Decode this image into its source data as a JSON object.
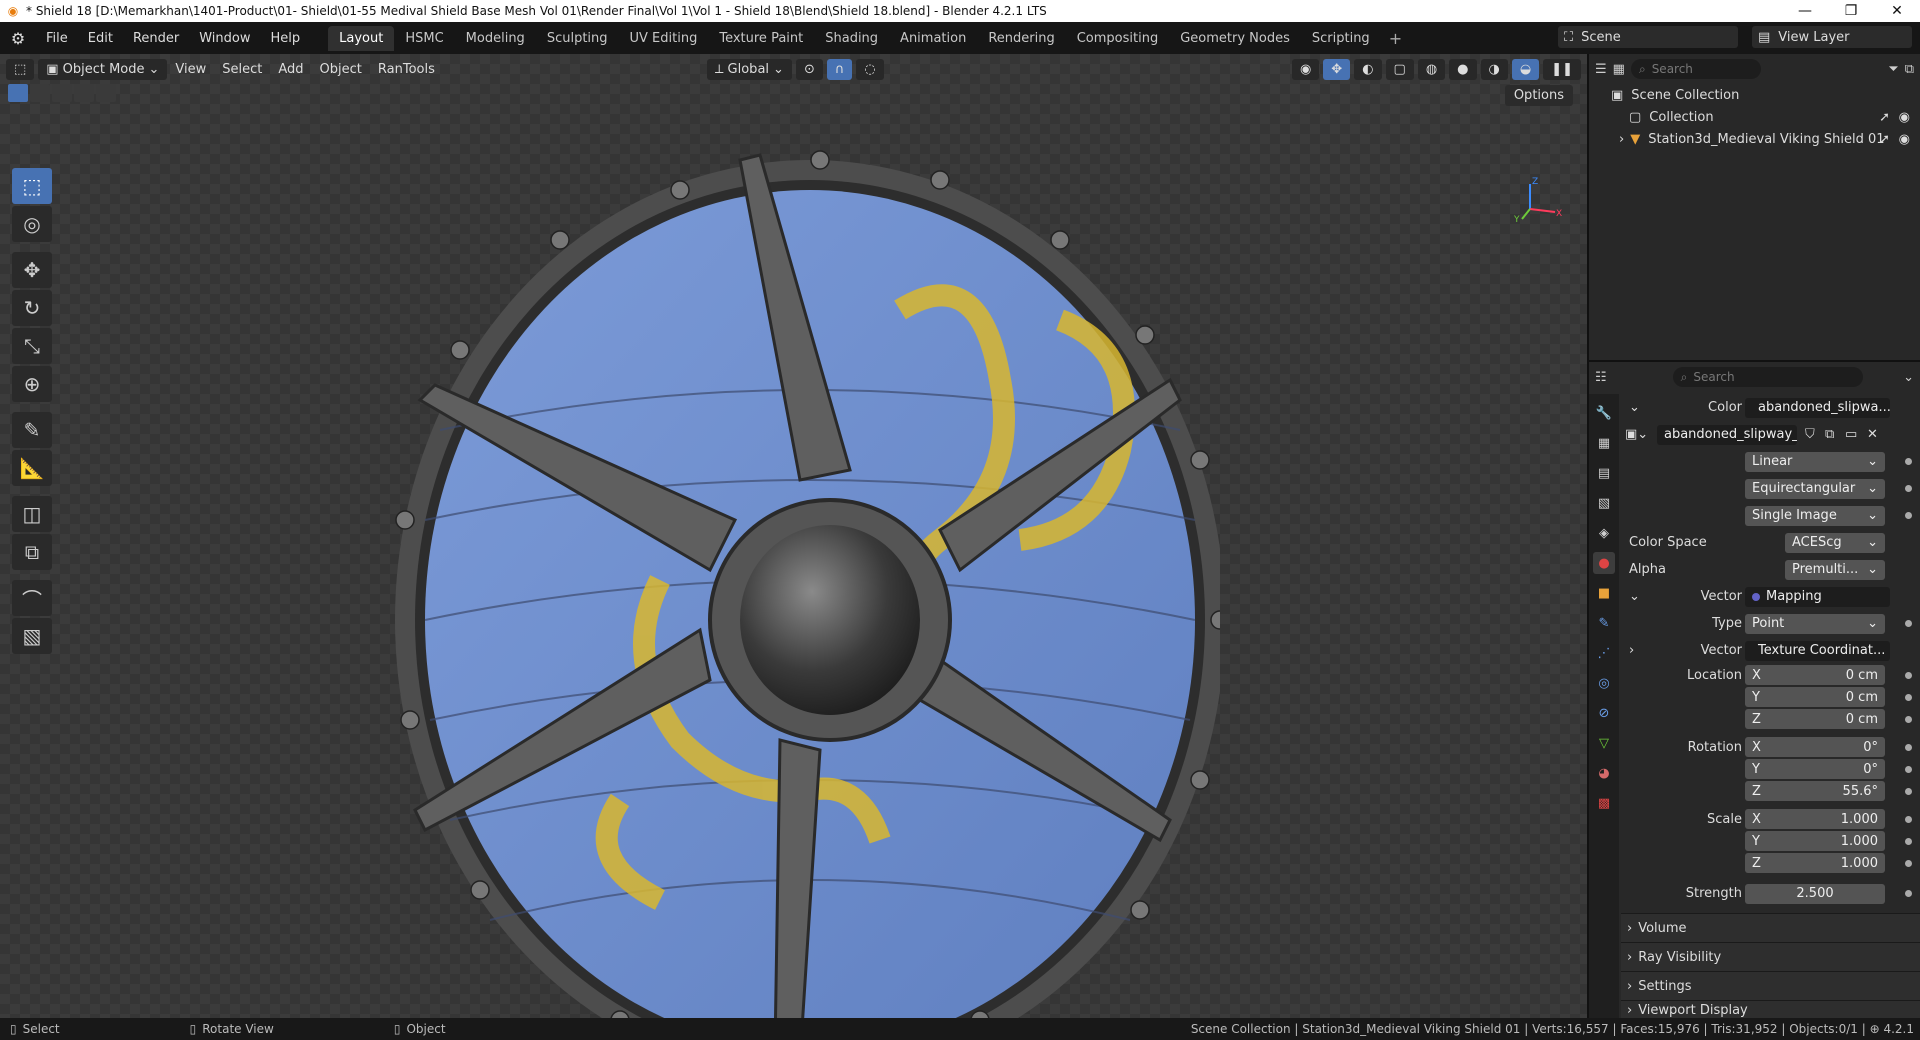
{
  "titlebar": {
    "title": "* Shield 18 [D:\\Memarkhan\\1401-Product\\01- Shield\\01-55 Medival Shield Base Mesh Vol 01\\Render Final\\Vol 1\\Vol 1 - Shield 18\\Blend\\Shield 18.blend] - Blender 4.2.1 LTS",
    "minimize": "—",
    "maximize": "❐",
    "close": "✕"
  },
  "menus": [
    "File",
    "Edit",
    "Render",
    "Window",
    "Help"
  ],
  "workspaces": [
    "Layout",
    "HSMC",
    "Modeling",
    "Sculpting",
    "UV Editing",
    "Texture Paint",
    "Shading",
    "Animation",
    "Rendering",
    "Compositing",
    "Geometry Nodes",
    "Scripting"
  ],
  "active_workspace": "Layout",
  "scene": {
    "label": "Scene",
    "view_layer": "View Layer"
  },
  "viewport": {
    "mode": "Object Mode",
    "menus": [
      "View",
      "Select",
      "Add",
      "Object",
      "RanTools"
    ],
    "transform": "Global",
    "options": "Options",
    "gizmo": {
      "x": "X",
      "y": "Y",
      "z": "Z"
    }
  },
  "outliner": {
    "search_placeholder": "Search",
    "rows": [
      {
        "label": "Scene Collection"
      },
      {
        "label": "Collection"
      },
      {
        "label": "Station3d_Medieval Viking Shield 01"
      }
    ]
  },
  "properties": {
    "search_placeholder": "Search",
    "color_label": "Color",
    "color_value": "abandoned_slipwa...",
    "image_name": "abandoned_slipway_...",
    "interpolation": "Linear",
    "projection": "Equirectangular",
    "source": "Single Image",
    "color_space_label": "Color Space",
    "color_space": "ACEScg",
    "alpha_label": "Alpha",
    "alpha": "Premulti...",
    "vector_label": "Vector",
    "vector_value": "Mapping",
    "type_label": "Type",
    "type_value": "Point",
    "vector2_label": "Vector",
    "vector2_value": "Texture Coordinat...",
    "location_label": "Location",
    "location": [
      {
        "axis": "X",
        "value": "0 cm"
      },
      {
        "axis": "Y",
        "value": "0 cm"
      },
      {
        "axis": "Z",
        "value": "0 cm"
      }
    ],
    "rotation_label": "Rotation",
    "rotation": [
      {
        "axis": "X",
        "value": "0°"
      },
      {
        "axis": "Y",
        "value": "0°"
      },
      {
        "axis": "Z",
        "value": "55.6°"
      }
    ],
    "scale_label": "Scale",
    "scale": [
      {
        "axis": "X",
        "value": "1.000"
      },
      {
        "axis": "Y",
        "value": "1.000"
      },
      {
        "axis": "Z",
        "value": "1.000"
      }
    ],
    "strength_label": "Strength",
    "strength": "2.500",
    "panels": [
      "Volume",
      "Ray Visibility",
      "Settings",
      "Viewport Display"
    ]
  },
  "status": {
    "select": "Select",
    "rotate": "Rotate View",
    "object": "Object",
    "info": "Scene Collection | Station3d_Medieval Viking Shield 01 | Verts:16,557 | Faces:15,976 | Tris:31,952 | Objects:0/1 | ",
    "version": "4.2.1"
  },
  "colors": {
    "accent": "#4772b3",
    "shield_blue": "#6f8fce",
    "dragon_yellow": "#d8b730",
    "metal": "#6b6b6b"
  }
}
